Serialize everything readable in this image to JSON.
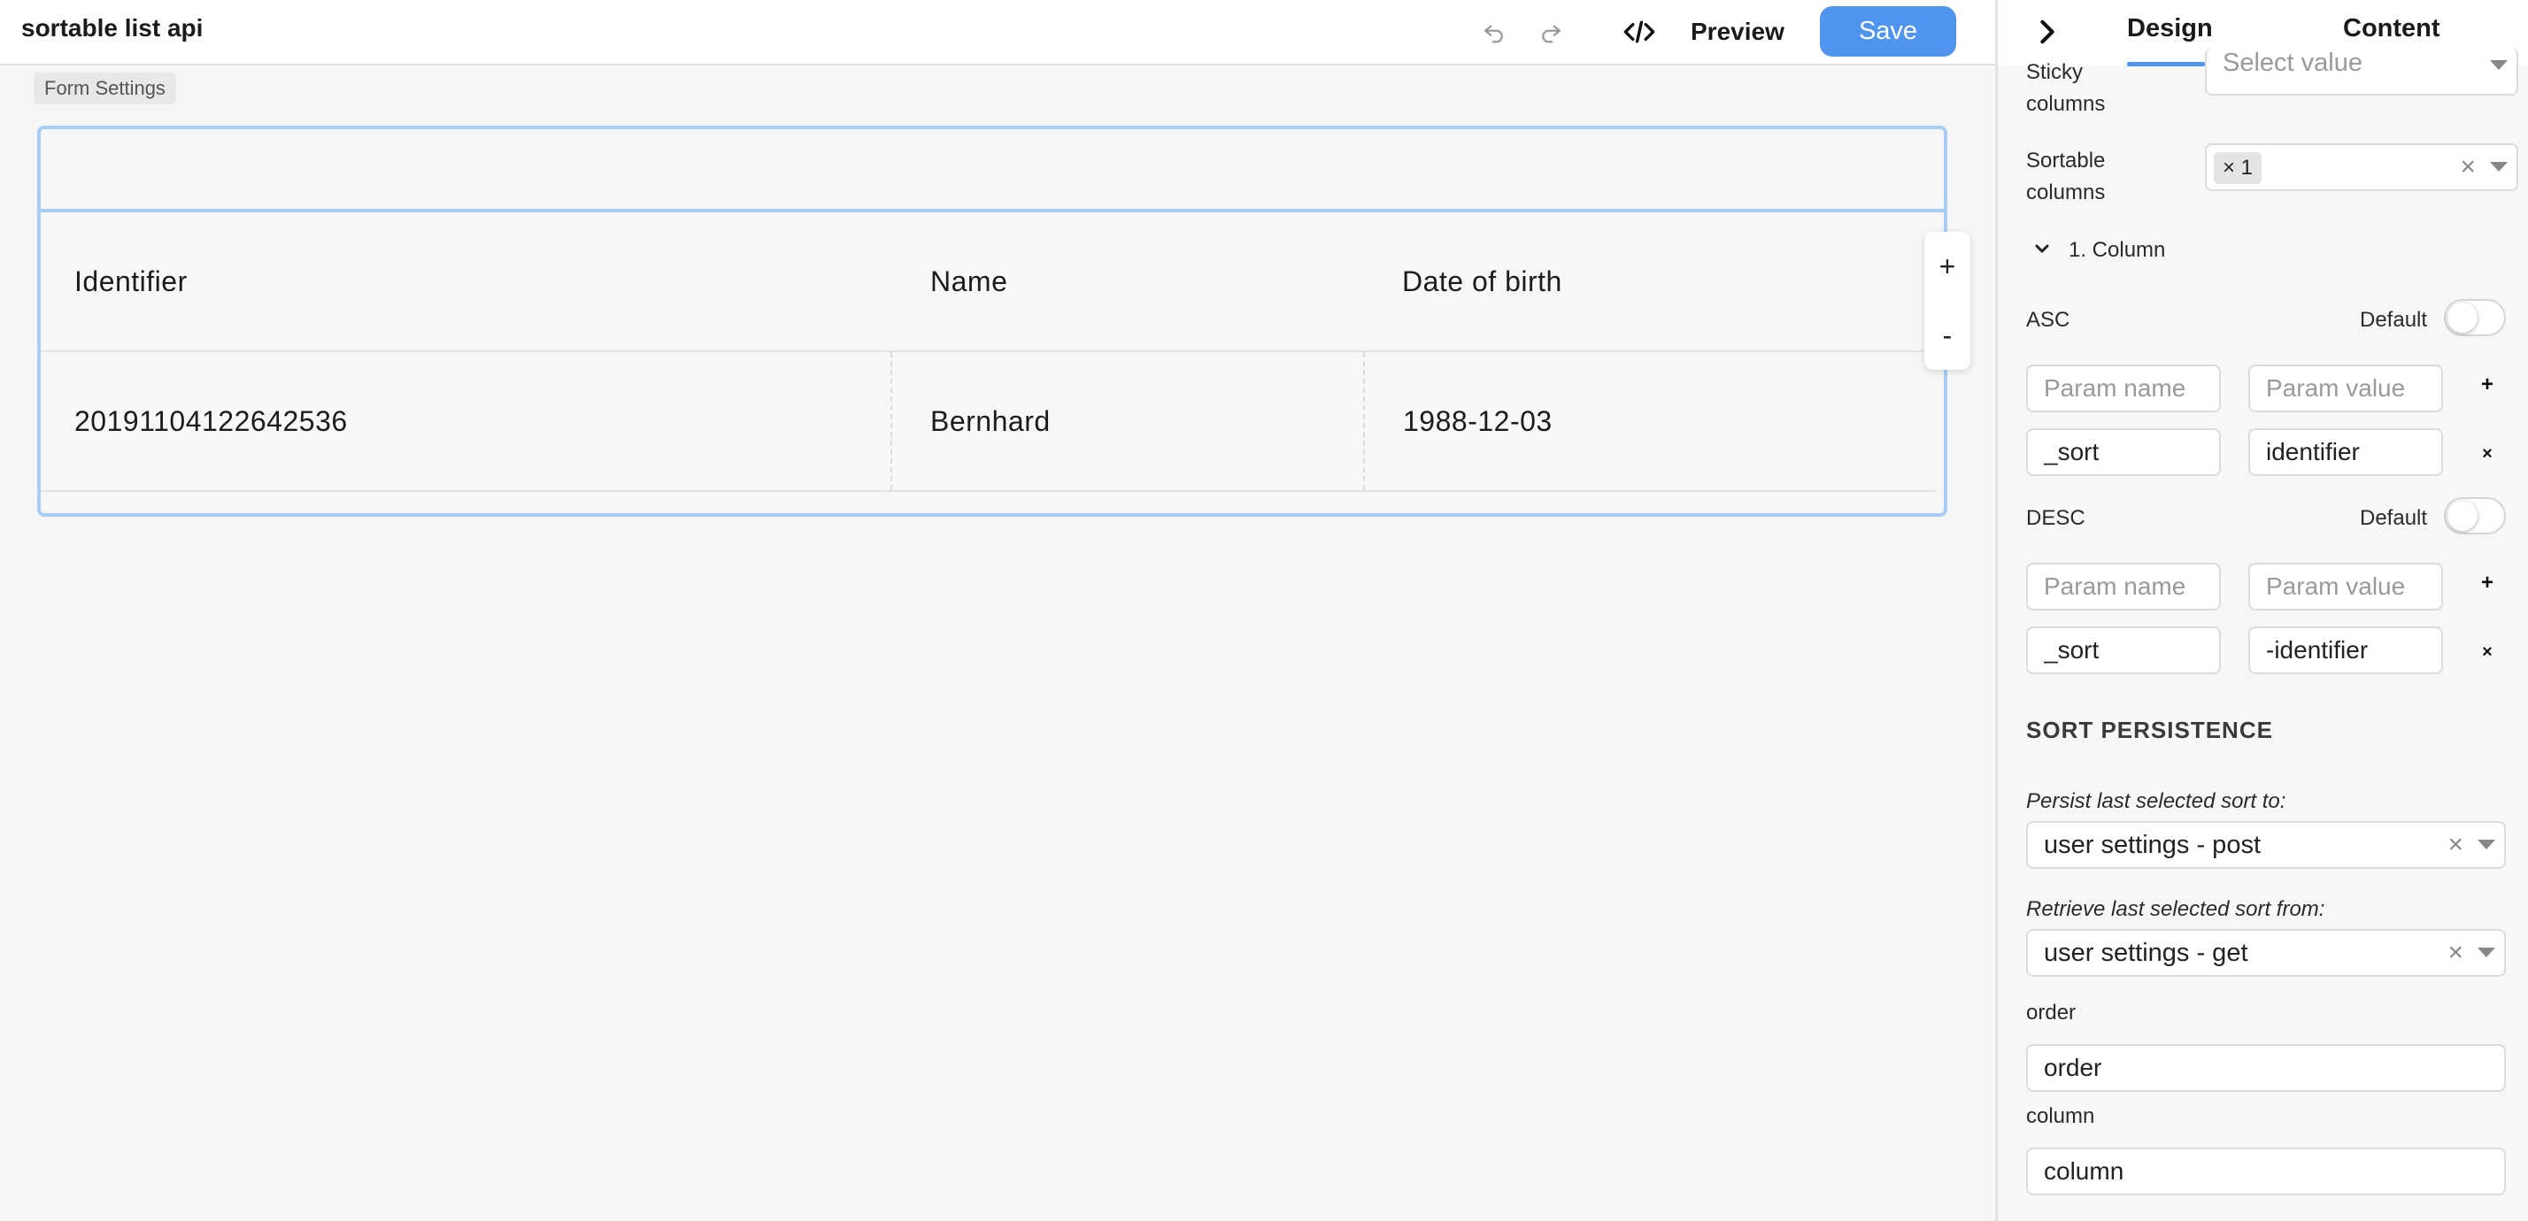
{
  "app": {
    "title": "sortable list api"
  },
  "toolbar": {
    "preview_label": "Preview",
    "save_label": "Save"
  },
  "canvas": {
    "form_settings_label": "Form Settings",
    "table": {
      "headers": [
        "Identifier",
        "Name",
        "Date of birth"
      ],
      "rows": [
        [
          "20191104122642536",
          "Bernhard",
          "1988-12-03"
        ]
      ]
    },
    "controls": {
      "add": "+",
      "remove": "-"
    }
  },
  "panel": {
    "tabs": [
      "Design",
      "Content"
    ],
    "active_tab": "Design",
    "sticky_columns": {
      "label_line1": "Sticky",
      "label_line2": "columns",
      "placeholder": "Select value"
    },
    "sortable_columns": {
      "label_line1": "Sortable",
      "label_line2": "columns",
      "chip": "× 1"
    },
    "column_group": {
      "label": "1. Column"
    },
    "asc": {
      "label": "ASC",
      "default_label": "Default",
      "default_on": false,
      "param_name_placeholder": "Param name",
      "param_value_placeholder": "Param value",
      "param_name": "_sort",
      "param_value": "identifier"
    },
    "desc": {
      "label": "DESC",
      "default_label": "Default",
      "default_on": false,
      "param_name_placeholder": "Param name",
      "param_value_placeholder": "Param value",
      "param_name": "_sort",
      "param_value": "-identifier"
    },
    "sort_persistence": {
      "title": "SORT PERSISTENCE",
      "persist_label": "Persist last selected sort to:",
      "persist_value": "user settings - post",
      "retrieve_label": "Retrieve last selected sort from:",
      "retrieve_value": "user settings - get",
      "order_label": "order",
      "order_value": "order",
      "column_label": "column",
      "column_value": "column"
    }
  },
  "colors": {
    "accent": "#4f95ef",
    "frame": "#a7cdf5",
    "background": "#f6f6f6"
  }
}
